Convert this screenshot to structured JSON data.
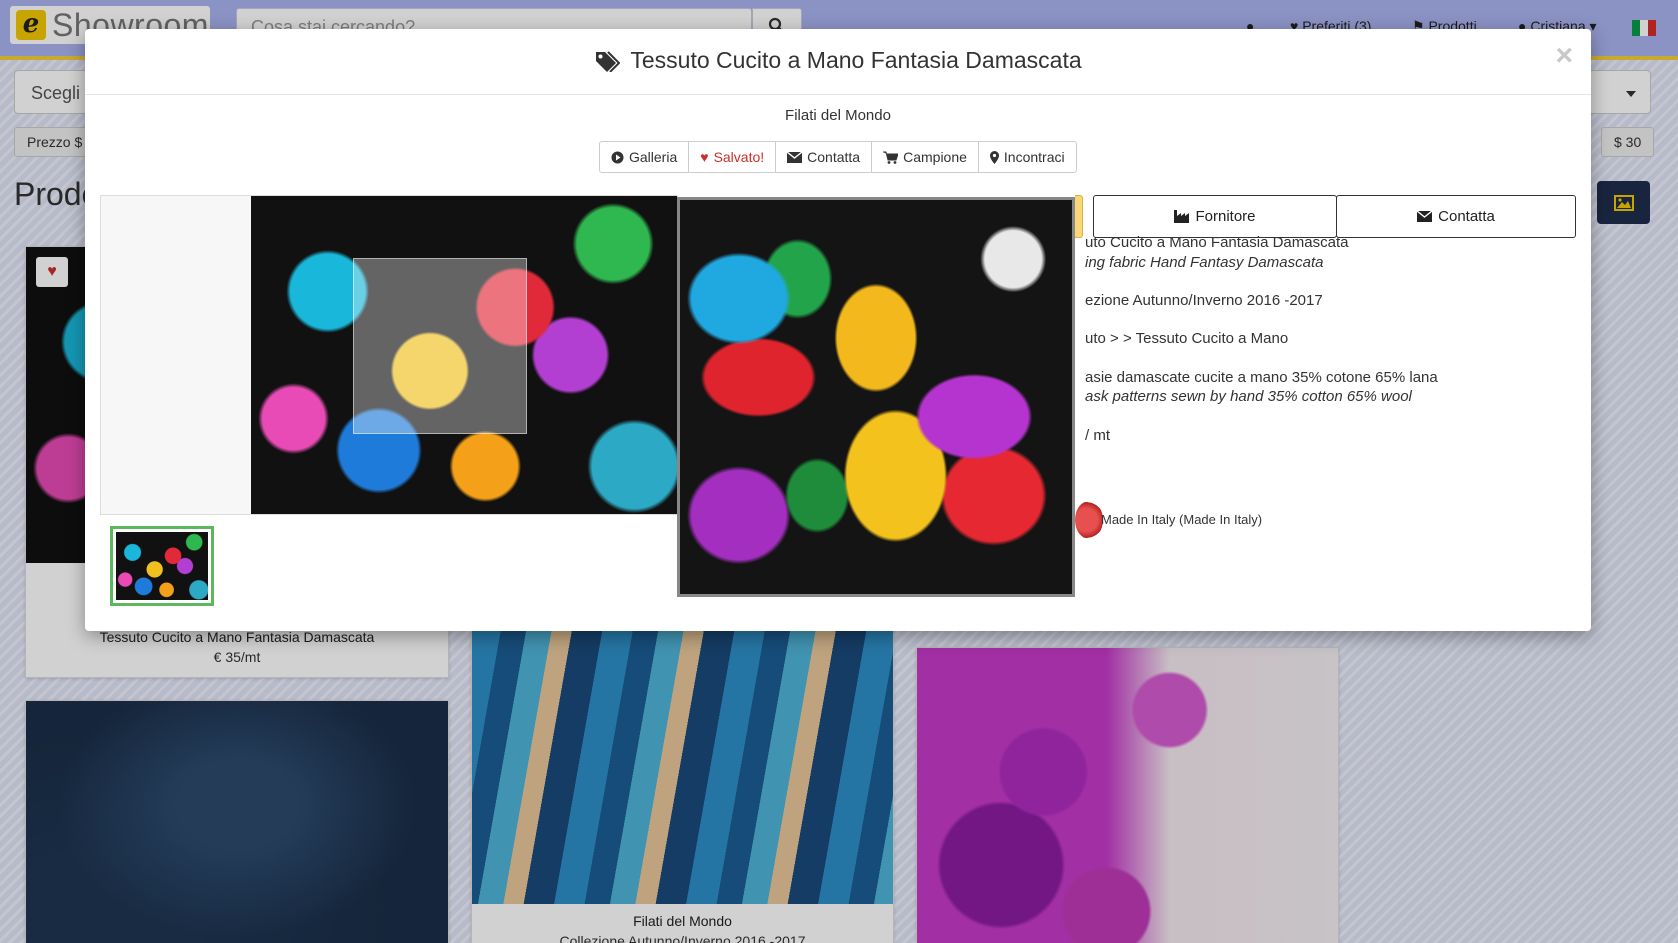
{
  "header": {
    "logo_letter": "e",
    "logo_text": "Showroom",
    "search_placeholder": "Cosa stai cercando?",
    "nav": {
      "favorites": "Preferiti (3)",
      "products": "Prodotti",
      "user": "Cristiana"
    }
  },
  "filters": {
    "category_placeholder": "Scegli c",
    "price_min_label": "Prezzo $",
    "price_max_label": "$ 30"
  },
  "page": {
    "heading": "Prodo"
  },
  "cards": [
    {
      "title": "Tessuto Cucito a Mano Fantasia Damascata",
      "price": "€ 35/mt"
    },
    {
      "supplier": "Filati del Mondo",
      "collection": "Collezione Autunno/Inverno 2016 -2017"
    }
  ],
  "modal": {
    "title": "Tessuto Cucito a Mano Fantasia Damascata",
    "supplier": "Filati del Mondo",
    "actions": [
      {
        "label": "Galleria",
        "icon": "play-circle-icon"
      },
      {
        "label": "Salvato!",
        "icon": "heart-icon"
      },
      {
        "label": "Contatta",
        "icon": "envelope-icon"
      },
      {
        "label": "Campione",
        "icon": "cart-icon"
      },
      {
        "label": "Incontraci",
        "icon": "map-marker-icon"
      }
    ],
    "tabs": {
      "supplier": "Fornitore",
      "contact": "Contatta"
    },
    "info": {
      "name_it": "uto Cucito a Mano Fantasia Damascata",
      "name_en": "ing fabric Hand Fantasy Damascata",
      "collection": "ezione Autunno/Inverno 2016 -2017",
      "category": "uto > > Tessuto Cucito a Mano",
      "description_it": "asie damascate cucite a mano 35% cotone 65% lana",
      "description_en": "ask patterns sewn by hand 35% cotton 65% wool",
      "unit": "/ mt",
      "origin": "Made In Italy (Made In Italy)"
    },
    "close_symbol": "×"
  },
  "colors": {
    "topbar": "#aab3f0",
    "accent_yellow": "#f7cf3c",
    "saved_red": "#c9302c",
    "thumb_selected": "#5cb85c",
    "image_button": "#1f2c4c"
  }
}
